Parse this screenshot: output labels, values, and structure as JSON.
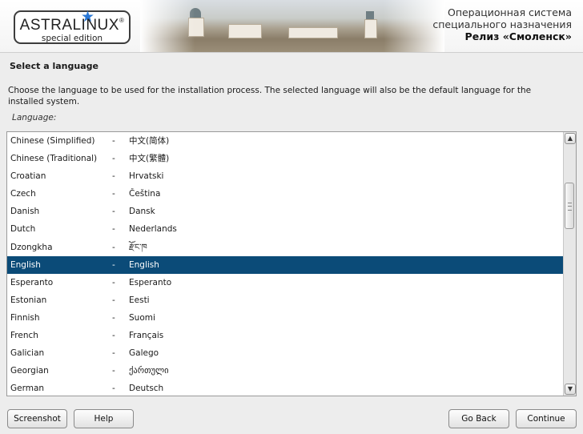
{
  "header": {
    "logo_name": "ASTRALINUX",
    "logo_reg": "®",
    "logo_subtitle": "special edition",
    "os_line1": "Операционная система",
    "os_line2": "специального назначения",
    "release": "Релиз «Смоленск»"
  },
  "page": {
    "title": "Select a language",
    "description": "Choose the language to be used for the installation process. The selected language will also be the default language for the installed system.",
    "list_label": "Language:"
  },
  "languages": [
    {
      "name": "Chinese (Simplified)",
      "sep": "-",
      "native": "中文(简体)",
      "selected": false
    },
    {
      "name": "Chinese (Traditional)",
      "sep": "-",
      "native": "中文(繁體)",
      "selected": false
    },
    {
      "name": "Croatian",
      "sep": "-",
      "native": "Hrvatski",
      "selected": false
    },
    {
      "name": "Czech",
      "sep": "-",
      "native": "Čeština",
      "selected": false
    },
    {
      "name": "Danish",
      "sep": "-",
      "native": "Dansk",
      "selected": false
    },
    {
      "name": "Dutch",
      "sep": "-",
      "native": "Nederlands",
      "selected": false
    },
    {
      "name": "Dzongkha",
      "sep": "-",
      "native": "རྫོང་ཁ",
      "selected": false
    },
    {
      "name": "English",
      "sep": "-",
      "native": "English",
      "selected": true
    },
    {
      "name": "Esperanto",
      "sep": "-",
      "native": "Esperanto",
      "selected": false
    },
    {
      "name": "Estonian",
      "sep": "-",
      "native": "Eesti",
      "selected": false
    },
    {
      "name": "Finnish",
      "sep": "-",
      "native": "Suomi",
      "selected": false
    },
    {
      "name": "French",
      "sep": "-",
      "native": "Français",
      "selected": false
    },
    {
      "name": "Galician",
      "sep": "-",
      "native": "Galego",
      "selected": false
    },
    {
      "name": "Georgian",
      "sep": "-",
      "native": "ქართული",
      "selected": false
    },
    {
      "name": "German",
      "sep": "-",
      "native": "Deutsch",
      "selected": false
    }
  ],
  "buttons": {
    "screenshot": "Screenshot",
    "help": "Help",
    "back": "Go Back",
    "continue": "Continue"
  },
  "colors": {
    "selection": "#0b4b78",
    "logo_star": "#2a78d6"
  },
  "icons": {
    "scroll_up": "scroll-up-arrow-icon",
    "scroll_down": "scroll-down-arrow-icon",
    "logo_star": "star-icon"
  }
}
